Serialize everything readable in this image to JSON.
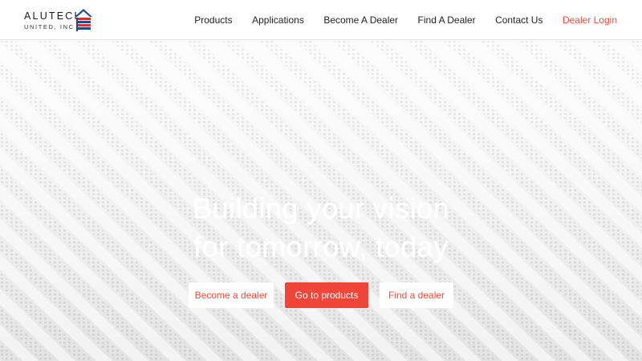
{
  "brand": {
    "name": "ALUTECH",
    "tagline": "UNITED, INC",
    "colors": {
      "red": "#d8312a",
      "blue": "#1f4a8f"
    }
  },
  "nav": {
    "items": [
      {
        "label": "Products"
      },
      {
        "label": "Applications"
      },
      {
        "label": "Become A Dealer"
      },
      {
        "label": "Find A Dealer"
      },
      {
        "label": "Contact Us"
      },
      {
        "label": "Dealer Login"
      }
    ],
    "accent": "#ef4a3c"
  },
  "hero": {
    "title_line1": "Building your vision",
    "title_line2": "for tomorrow, today",
    "background": "perforated-aluminum-soffit-panels",
    "buttons": {
      "become_dealer": "Become a dealer",
      "go_products": "Go to products",
      "find_dealer": "Find a dealer"
    }
  }
}
